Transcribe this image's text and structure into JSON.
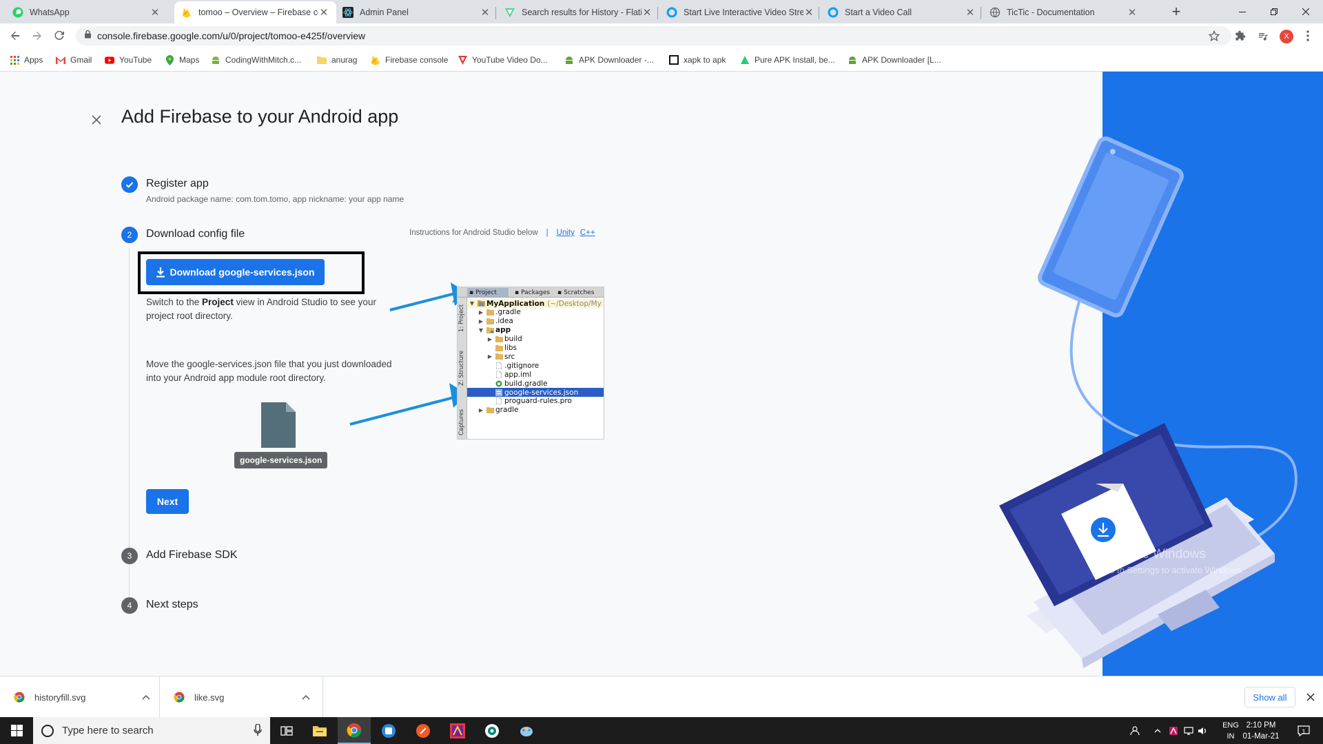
{
  "browser": {
    "tabs": [
      {
        "title": "WhatsApp",
        "icon": "whatsapp-icon",
        "active": false
      },
      {
        "title": "tomoo – Overview – Firebase console",
        "icon": "firebase-icon",
        "active": true
      },
      {
        "title": "Admin Panel",
        "icon": "react-icon",
        "active": false
      },
      {
        "title": "Search results for History - Flaticon",
        "icon": "flaticon-icon",
        "active": false
      },
      {
        "title": "Start Live Interactive Video Stream",
        "icon": "agora-icon",
        "active": false
      },
      {
        "title": "Start a Video Call",
        "icon": "agora-icon",
        "active": false
      },
      {
        "title": "TicTic - Documentation",
        "icon": "globe-icon",
        "active": false
      }
    ],
    "new_tab_label": "+",
    "url": "console.firebase.google.com/u/0/project/tomoo-e425f/overview",
    "profile_initial": "X",
    "profile_color": "#e8453c",
    "bookmarks": [
      {
        "label": "Apps",
        "icon": "apps-grid-icon"
      },
      {
        "label": "Gmail",
        "icon": "gmail-icon"
      },
      {
        "label": "YouTube",
        "icon": "youtube-icon"
      },
      {
        "label": "Maps",
        "icon": "maps-icon"
      },
      {
        "label": "CodingWithMitch.c...",
        "icon": "android-icon"
      },
      {
        "label": "anurag",
        "icon": "folder-icon"
      },
      {
        "label": "Firebase console",
        "icon": "firebase-icon"
      },
      {
        "label": "YouTube Video Do...",
        "icon": "vidmate-icon"
      },
      {
        "label": "APK Downloader -...",
        "icon": "apk-icon"
      },
      {
        "label": "xapk to apk",
        "icon": "xapk-icon"
      },
      {
        "label": "Pure APK Install, be...",
        "icon": "apkpure-icon"
      },
      {
        "label": "APK Downloader [L...",
        "icon": "apk-icon"
      }
    ]
  },
  "page": {
    "title": "Add Firebase to your Android app",
    "accent_color": "#1a73e8",
    "steps": [
      {
        "number": "",
        "label": "Register app",
        "detail": "Android package name: com.tom.tomo, app nickname: your app name",
        "state": "done"
      },
      {
        "number": "2",
        "label": "Download config file",
        "state": "active"
      },
      {
        "number": "3",
        "label": "Add Firebase SDK",
        "state": "pending"
      },
      {
        "number": "4",
        "label": "Next steps",
        "state": "pending"
      }
    ],
    "instructions_label": "Instructions for Android Studio below",
    "instruction_links": [
      "Unity",
      "C++"
    ],
    "download_button_label": "Download google-services.json",
    "para1_before": "Switch to the ",
    "para1_bold": "Project",
    "para1_after": " view in Android Studio to see your project root directory.",
    "para2": "Move the google-services.json file that you just downloaded into your Android app module root directory.",
    "file_badge": "google-services.json",
    "next_button_label": "Next",
    "android_studio": {
      "tabs": [
        "Project",
        "Packages",
        "Scratches"
      ],
      "side_labels": [
        "1: Project",
        "Z: Structure",
        "Captures"
      ],
      "tree": [
        {
          "label": "MyApplication",
          "path": "(~/Desktop/My",
          "level": 0,
          "expanded": true,
          "type": "project"
        },
        {
          "label": ".gradle",
          "level": 1,
          "expanded": false,
          "type": "folder"
        },
        {
          "label": ".idea",
          "level": 1,
          "expanded": false,
          "type": "folder"
        },
        {
          "label": "app",
          "level": 1,
          "expanded": true,
          "type": "module"
        },
        {
          "label": "build",
          "level": 2,
          "expanded": false,
          "type": "folder"
        },
        {
          "label": "libs",
          "level": 2,
          "expanded": null,
          "type": "folder"
        },
        {
          "label": "src",
          "level": 2,
          "expanded": false,
          "type": "folder"
        },
        {
          "label": ".gitignore",
          "level": 2,
          "expanded": null,
          "type": "file"
        },
        {
          "label": "app.iml",
          "level": 2,
          "expanded": null,
          "type": "file"
        },
        {
          "label": "build.gradle",
          "level": 2,
          "expanded": null,
          "type": "gradle"
        },
        {
          "label": "google-services.json",
          "level": 2,
          "expanded": null,
          "type": "json",
          "selected": true
        },
        {
          "label": "proguard-rules.pro",
          "level": 2,
          "expanded": null,
          "type": "file"
        },
        {
          "label": "gradle",
          "level": 1,
          "expanded": false,
          "type": "folder"
        }
      ]
    },
    "watermark_title": "Activate Windows",
    "watermark_sub": "Go to Settings to activate Windows."
  },
  "download_shelf": {
    "items": [
      {
        "name": "historyfill.svg",
        "icon": "chrome-icon"
      },
      {
        "name": "like.svg",
        "icon": "chrome-icon"
      }
    ],
    "show_all_label": "Show all"
  },
  "taskbar": {
    "search_placeholder": "Type here to search",
    "apps": [
      "task-view-icon",
      "file-explorer-icon",
      "chrome-icon",
      "windows-app-icon",
      "postman-icon",
      "android-studio-icon",
      "app-icon",
      "paint-icon"
    ],
    "lang_line1": "ENG",
    "lang_line2": "IN",
    "time": "2:10 PM",
    "date": "01-Mar-21",
    "notification_count": "1"
  }
}
